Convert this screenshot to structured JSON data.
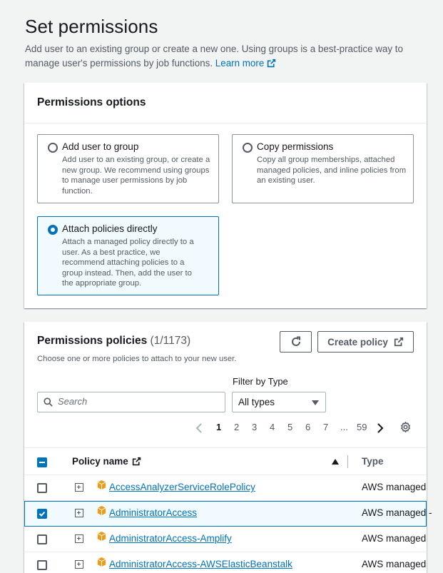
{
  "header": {
    "title": "Set permissions",
    "description": "Add user to an existing group or create a new one. Using groups is a best-practice way to manage user's permissions by job functions.",
    "learn_more": "Learn more"
  },
  "permissions_options": {
    "title": "Permissions options",
    "options": [
      {
        "label": "Add user to group",
        "description": "Add user to an existing group, or create a new group. We recommend using groups to manage user permissions by job function.",
        "selected": false
      },
      {
        "label": "Copy permissions",
        "description": "Copy all group memberships, attached managed policies, and inline policies from an existing user.",
        "selected": false
      },
      {
        "label": "Attach policies directly",
        "description": "Attach a managed policy directly to a user. As a best practice, we recommend attaching policies to a group instead. Then, add the user to the appropriate group.",
        "selected": true
      }
    ]
  },
  "policies": {
    "title": "Permissions policies",
    "count": "(1/1173)",
    "description": "Choose one or more policies to attach to your new user.",
    "refresh_icon": "refresh-icon",
    "create_policy_label": "Create policy",
    "filter_label": "Filter by Type",
    "search_placeholder": "Search",
    "filter_value": "All types",
    "pagination": {
      "pages": [
        "1",
        "2",
        "3",
        "4",
        "5",
        "6",
        "7",
        "...",
        "59"
      ],
      "current": "1"
    },
    "table": {
      "col_name": "Policy name",
      "col_type": "Type",
      "rows": [
        {
          "name": "AccessAnalyzerServiceRolePolicy",
          "type": "AWS managed",
          "checked": false
        },
        {
          "name": "AdministratorAccess",
          "type": "AWS managed - ",
          "checked": true
        },
        {
          "name": "AdministratorAccess-Amplify",
          "type": "AWS managed",
          "checked": false
        },
        {
          "name": "AdministratorAccess-AWSElasticBeanstalk",
          "type": "AWS managed",
          "checked": false
        }
      ]
    }
  },
  "colors": {
    "accent": "#0073bb",
    "selected_bg": "#f1faff",
    "policy_icon": "#ec9d1c"
  }
}
